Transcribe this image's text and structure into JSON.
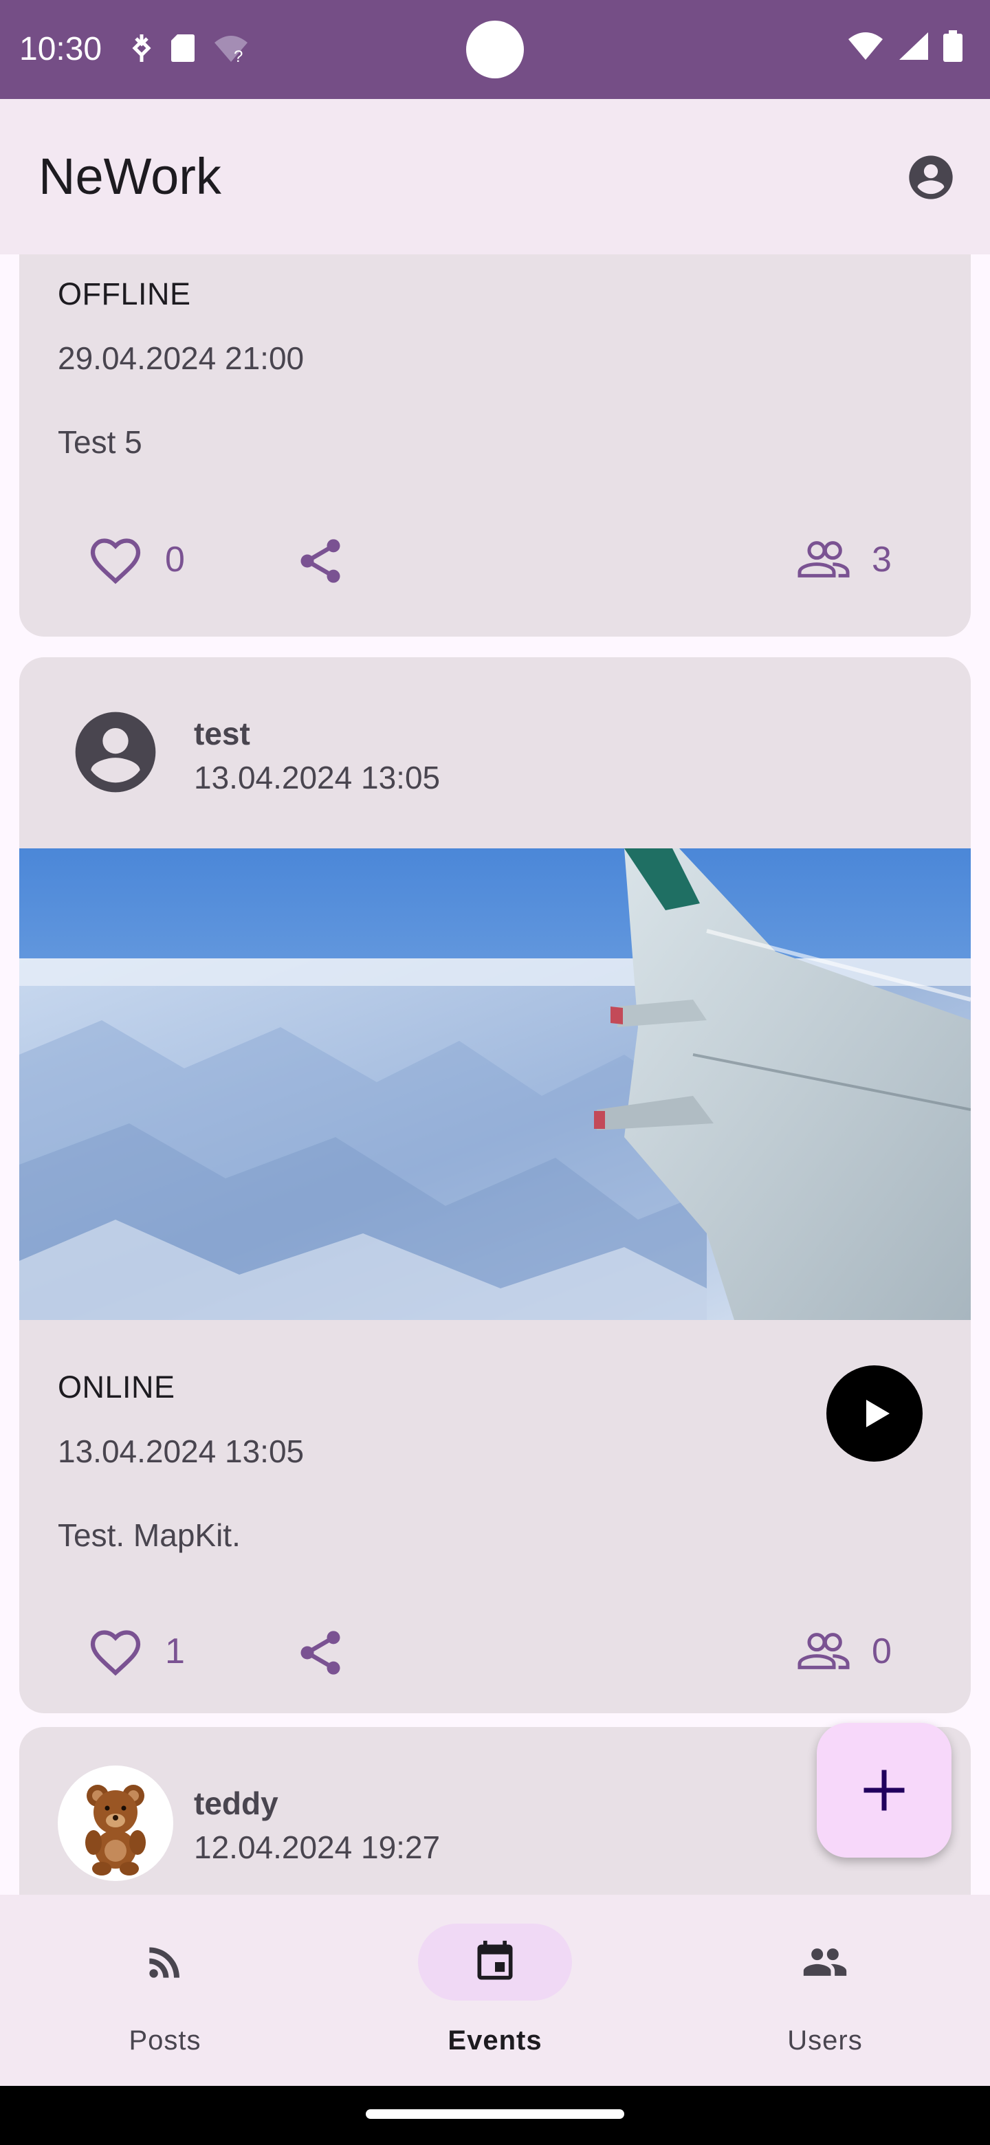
{
  "status_bar": {
    "time": "10:30",
    "icons": [
      "usb-debug-icon",
      "sd-card-icon",
      "wifi-question-icon",
      "wifi-icon",
      "signal-icon",
      "battery-icon"
    ]
  },
  "app_bar": {
    "title": "NeWork",
    "account_icon": "account-circle-icon"
  },
  "events": [
    {
      "type": "OFFLINE",
      "datetime": "29.04.2024 21:00",
      "content": "Test 5",
      "likes": "0",
      "participants": "3"
    },
    {
      "author": "test",
      "published": "13.04.2024 13:05",
      "image": "airplane-wing-over-snowy-mountains",
      "type": "ONLINE",
      "datetime": "13.04.2024 13:05",
      "content": "Test. MapKit.",
      "likes": "1",
      "participants": "0",
      "has_audio": true
    },
    {
      "author": "teddy",
      "published": "12.04.2024 19:27",
      "avatar": "teddy-bear"
    }
  ],
  "fab": {
    "icon": "plus-icon"
  },
  "bottom_nav": {
    "items": [
      {
        "label": "Posts",
        "icon": "rss-feed-icon",
        "active": false
      },
      {
        "label": "Events",
        "icon": "calendar-icon",
        "active": true
      },
      {
        "label": "Users",
        "icon": "people-icon",
        "active": false
      }
    ]
  },
  "colors": {
    "status_bar": "#754e86",
    "accent": "#7a5292",
    "card": "#e8e0e6",
    "app_bar": "#f3e8f2",
    "fab": "#f7d8fa"
  }
}
